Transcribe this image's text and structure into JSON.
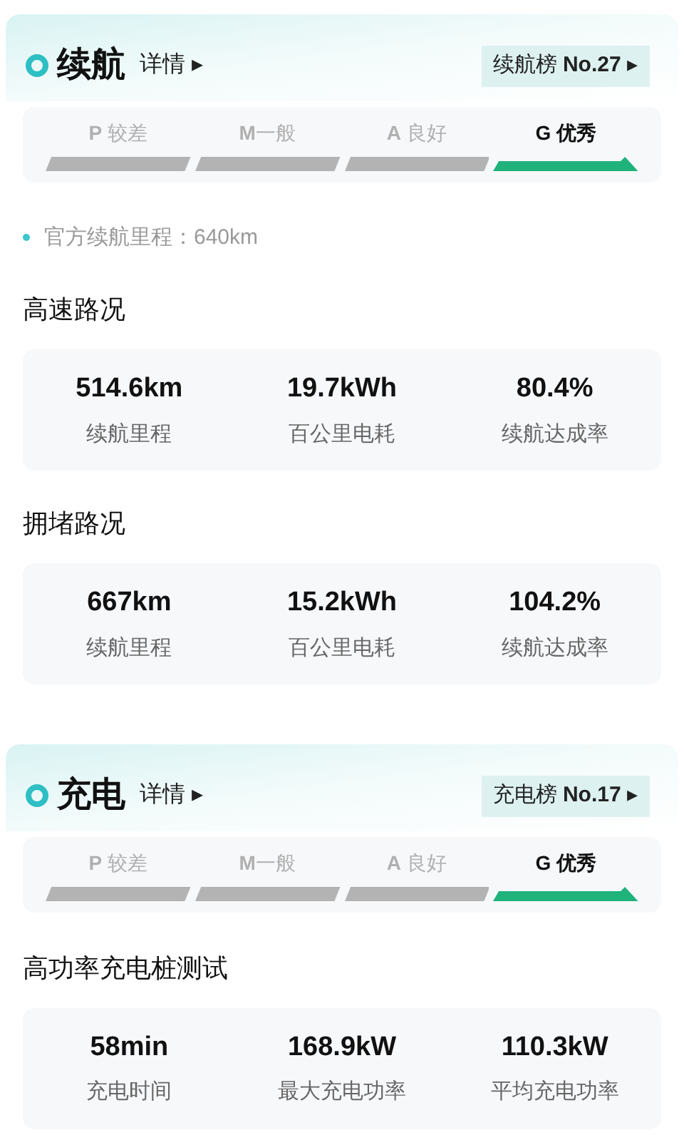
{
  "sections": [
    {
      "title": "续航",
      "detail": "详情 ▸",
      "rank": "续航榜 **No.27** ▸",
      "grades": [
        {
          "text": "**P** 较差",
          "selected": false
        },
        {
          "text": "**M**一般",
          "selected": false
        },
        {
          "text": "**A** 良好",
          "selected": false
        },
        {
          "text": "**G** 优秀",
          "selected": true
        }
      ],
      "note": "官方续航里程：640km",
      "groups": [
        {
          "title": "高速路况",
          "stats": [
            {
              "value": "514.6km",
              "label": "续航里程"
            },
            {
              "value": "19.7kWh",
              "label": "百公里电耗"
            },
            {
              "value": "80.4%",
              "label": "续航达成率"
            }
          ]
        },
        {
          "title": "拥堵路况",
          "stats": [
            {
              "value": "667km",
              "label": "续航里程"
            },
            {
              "value": "15.2kWh",
              "label": "百公里电耗"
            },
            {
              "value": "104.2%",
              "label": "续航达成率"
            }
          ]
        }
      ]
    },
    {
      "title": "充电",
      "detail": "详情 ▸",
      "rank": "充电榜 **No.17** ▸",
      "grades": [
        {
          "text": "**P** 较差",
          "selected": false
        },
        {
          "text": "**M**一般",
          "selected": false
        },
        {
          "text": "**A** 良好",
          "selected": false
        },
        {
          "text": "**G** 优秀",
          "selected": true
        }
      ],
      "groups": [
        {
          "title": "高功率充电桩测试",
          "stats": [
            {
              "value": "58min",
              "label": "充电时间"
            },
            {
              "value": "168.9kW",
              "label": "最大充电功率"
            },
            {
              "value": "110.3kW",
              "label": "平均充电功率"
            }
          ]
        }
      ]
    }
  ]
}
